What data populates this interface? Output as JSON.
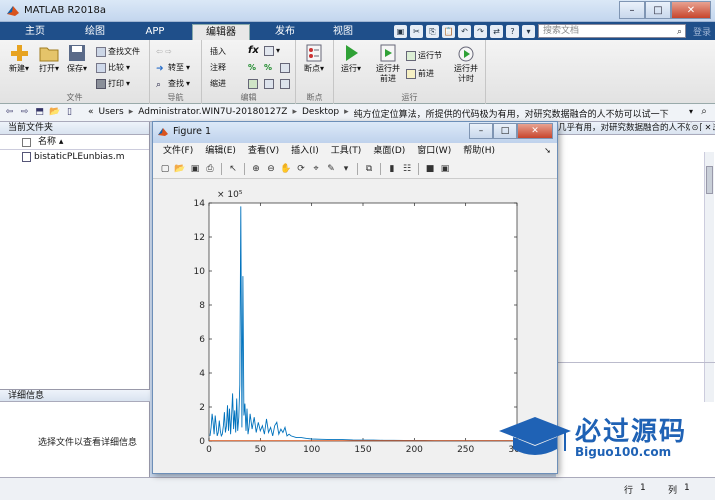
{
  "window": {
    "title": "MATLAB R2018a"
  },
  "ribbon_tabs": [
    {
      "label": "主页",
      "active": false
    },
    {
      "label": "绘图",
      "active": false
    },
    {
      "label": "APP",
      "active": false
    },
    {
      "label": "编辑器",
      "active": true
    },
    {
      "label": "发布",
      "active": false
    },
    {
      "label": "视图",
      "active": false
    }
  ],
  "search": {
    "placeholder": "搜索文档",
    "extra": "登录"
  },
  "ribbon": {
    "file_group": {
      "label": "文件",
      "new": "新建",
      "open": "打开",
      "save": "保存",
      "find_files": "查找文件",
      "compare": "比较",
      "print": "打印"
    },
    "nav_group": {
      "label": "导航",
      "goto": "转至",
      "find": "查找"
    },
    "edit_group": {
      "label": "编辑",
      "insert": "插入",
      "comment": "注释",
      "indent": "缩进"
    },
    "breakpoint_group": {
      "label": "断点",
      "breakpoints": "断点"
    },
    "run_group": {
      "label": "运行",
      "run": "运行",
      "run_advance_1": "运行并",
      "run_advance_2": "前进",
      "run_section": "运行节",
      "advance": "前进",
      "run_time_1": "运行并",
      "run_time_2": "计时"
    }
  },
  "address": {
    "segments": [
      "«",
      "Users",
      "Administrator.WIN7U-20180127Z",
      "Desktop",
      "纯方位定位算法，所提供的代码极为有用，对研究数据融合的人不妨可以试一下"
    ]
  },
  "current_folder": {
    "title": "当前文件夹",
    "column_name": "名称",
    "files": [
      "bistaticPLEunbias.m"
    ]
  },
  "details": {
    "title": "详细信息",
    "hint": "选择文件以查看详细信息"
  },
  "editor_header": "几乎有用，对研究数据融合的人不妨可以试一下",
  "status": {
    "row_label": "行",
    "row": "1",
    "col_label": "列",
    "col": "1"
  },
  "figure": {
    "title": "Figure 1",
    "menu": [
      "文件(F)",
      "编辑(E)",
      "查看(V)",
      "插入(I)",
      "工具(T)",
      "桌面(D)",
      "窗口(W)",
      "帮助(H)"
    ]
  },
  "chart_data": {
    "type": "line",
    "xlim": [
      0,
      300
    ],
    "ylim": [
      0,
      14
    ],
    "y_exponent_label": "× 10⁵",
    "xticks": [
      0,
      50,
      100,
      150,
      200,
      250,
      300
    ],
    "yticks": [
      0,
      2,
      4,
      6,
      8,
      10,
      12,
      14
    ],
    "series": [
      {
        "color": "#0072bd",
        "x": [
          1,
          2,
          3,
          4,
          5,
          6,
          7,
          8,
          9,
          10,
          11,
          12,
          13,
          14,
          15,
          16,
          17,
          18,
          19,
          20,
          21,
          22,
          23,
          24,
          25,
          26,
          27,
          28,
          29,
          30,
          31,
          32,
          33,
          34,
          35,
          36,
          37,
          38,
          39,
          40,
          42,
          44,
          46,
          48,
          50,
          52,
          54,
          56,
          58,
          60,
          62,
          64,
          66,
          68,
          70,
          72,
          74,
          76,
          78,
          80,
          85,
          90,
          95,
          100,
          110,
          120,
          130,
          140,
          150,
          160,
          170,
          180,
          190,
          200,
          210,
          220,
          230,
          240,
          250,
          260,
          270,
          280,
          290,
          300
        ],
        "y": [
          0.3,
          0.8,
          1.6,
          1.1,
          0.4,
          1.5,
          0.9,
          0.3,
          0.5,
          1.2,
          0.6,
          0.3,
          0.4,
          0.9,
          1.7,
          0.5,
          0.9,
          2.1,
          0.6,
          1.9,
          0.4,
          1.5,
          2.8,
          0.7,
          1.8,
          0.5,
          2.5,
          0.6,
          1.4,
          3.3,
          13.8,
          0.8,
          9.7,
          1.5,
          2.2,
          0.6,
          1.9,
          0.4,
          0.8,
          1.6,
          0.7,
          1.4,
          0.5,
          1.1,
          0.6,
          0.9,
          0.4,
          1.3,
          0.5,
          0.8,
          0.3,
          0.9,
          1.1,
          0.4,
          0.7,
          0.5,
          0.8,
          0.3,
          0.4,
          0.3,
          0.2,
          0.2,
          0.15,
          0.12,
          0.1,
          0.08,
          0.08,
          0.06,
          0.05,
          0.05,
          0.04,
          0.04,
          0.03,
          0.03,
          0.03,
          0.02,
          0.02,
          0.02,
          0.02,
          0.02,
          0.02,
          0.02,
          0.02,
          0.02
        ]
      },
      {
        "color": "#d95319",
        "x": [
          0,
          300
        ],
        "y": [
          0.02,
          0.02
        ]
      }
    ]
  },
  "watermark": {
    "text": "必过源码",
    "sub": "Biguo100.com"
  }
}
